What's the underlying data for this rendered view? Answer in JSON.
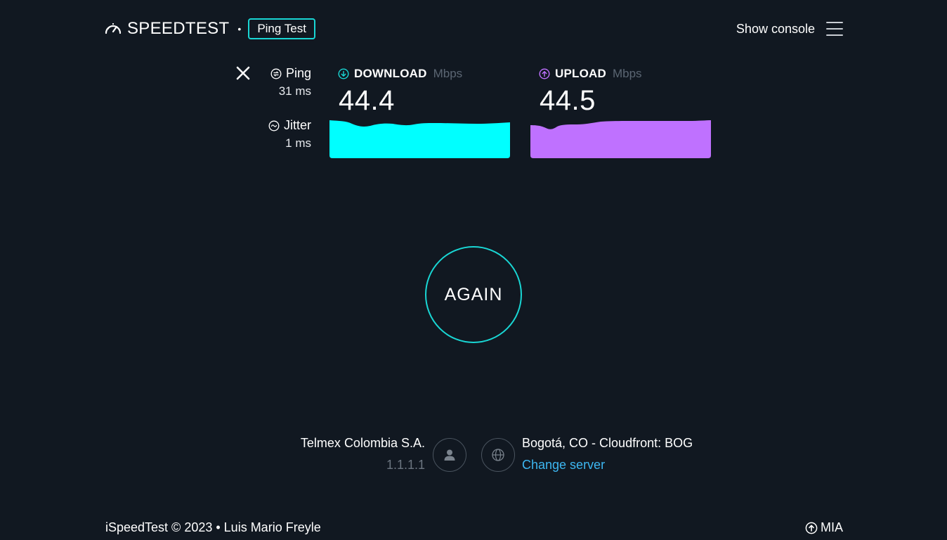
{
  "header": {
    "brand": "SPEEDTEST",
    "separator": "•",
    "mode_button": "Ping Test",
    "show_console": "Show console"
  },
  "metrics": {
    "ping": {
      "label": "Ping",
      "value": "31 ms"
    },
    "jitter": {
      "label": "Jitter",
      "value": "1 ms"
    }
  },
  "download": {
    "title": "DOWNLOAD",
    "unit": "Mbps",
    "value": "44.4",
    "color": "#00ffff"
  },
  "upload": {
    "title": "UPLOAD",
    "unit": "Mbps",
    "value": "44.5",
    "color": "#bf71ff"
  },
  "action": {
    "again_label": "AGAIN"
  },
  "provider": {
    "name": "Telmex Colombia S.A.",
    "ip": "1.1.1.1"
  },
  "server": {
    "name": "Bogotá, CO - Cloudfront: BOG",
    "change_label": "Change server"
  },
  "footer": {
    "credit": "iSpeedTest © 2023 • Luis Mario Freyle",
    "region": "MIA"
  },
  "colors": {
    "background": "#111821",
    "accent": "#19d6d4",
    "link": "#3db7f2"
  }
}
